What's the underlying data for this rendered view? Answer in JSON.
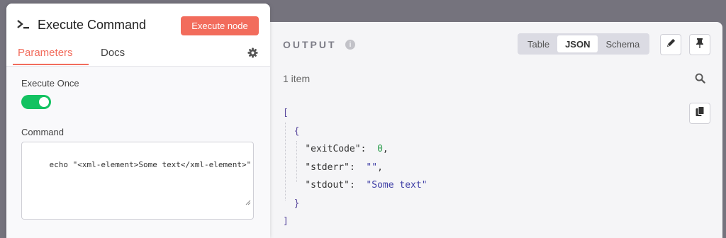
{
  "node": {
    "title": "Execute Command",
    "execute_label": "Execute node",
    "tabs": [
      {
        "label": "Parameters",
        "active": true
      },
      {
        "label": "Docs",
        "active": false
      }
    ],
    "execute_once_label": "Execute Once",
    "execute_once_value": true,
    "command_label": "Command",
    "command_value": "echo \"<xml-element>Some text</xml-element>\""
  },
  "output": {
    "title": "OUTPUT",
    "views": [
      {
        "label": "Table",
        "active": false
      },
      {
        "label": "JSON",
        "active": true
      },
      {
        "label": "Schema",
        "active": false
      }
    ],
    "item_count": "1 item",
    "json": {
      "open_array": "[",
      "open_obj": "{",
      "close_obj": "}",
      "close_array": "]",
      "fields": [
        {
          "key": "\"exitCode\"",
          "value": "0",
          "type": "number"
        },
        {
          "key": "\"stderr\"",
          "value": "\"\"",
          "type": "string"
        },
        {
          "key": "\"stdout\"",
          "value": "\"Some text\"",
          "type": "string"
        }
      ]
    }
  },
  "colors": {
    "accent": "#f26c5c",
    "toggle_on": "#13c261",
    "canvas": "#75737d"
  }
}
